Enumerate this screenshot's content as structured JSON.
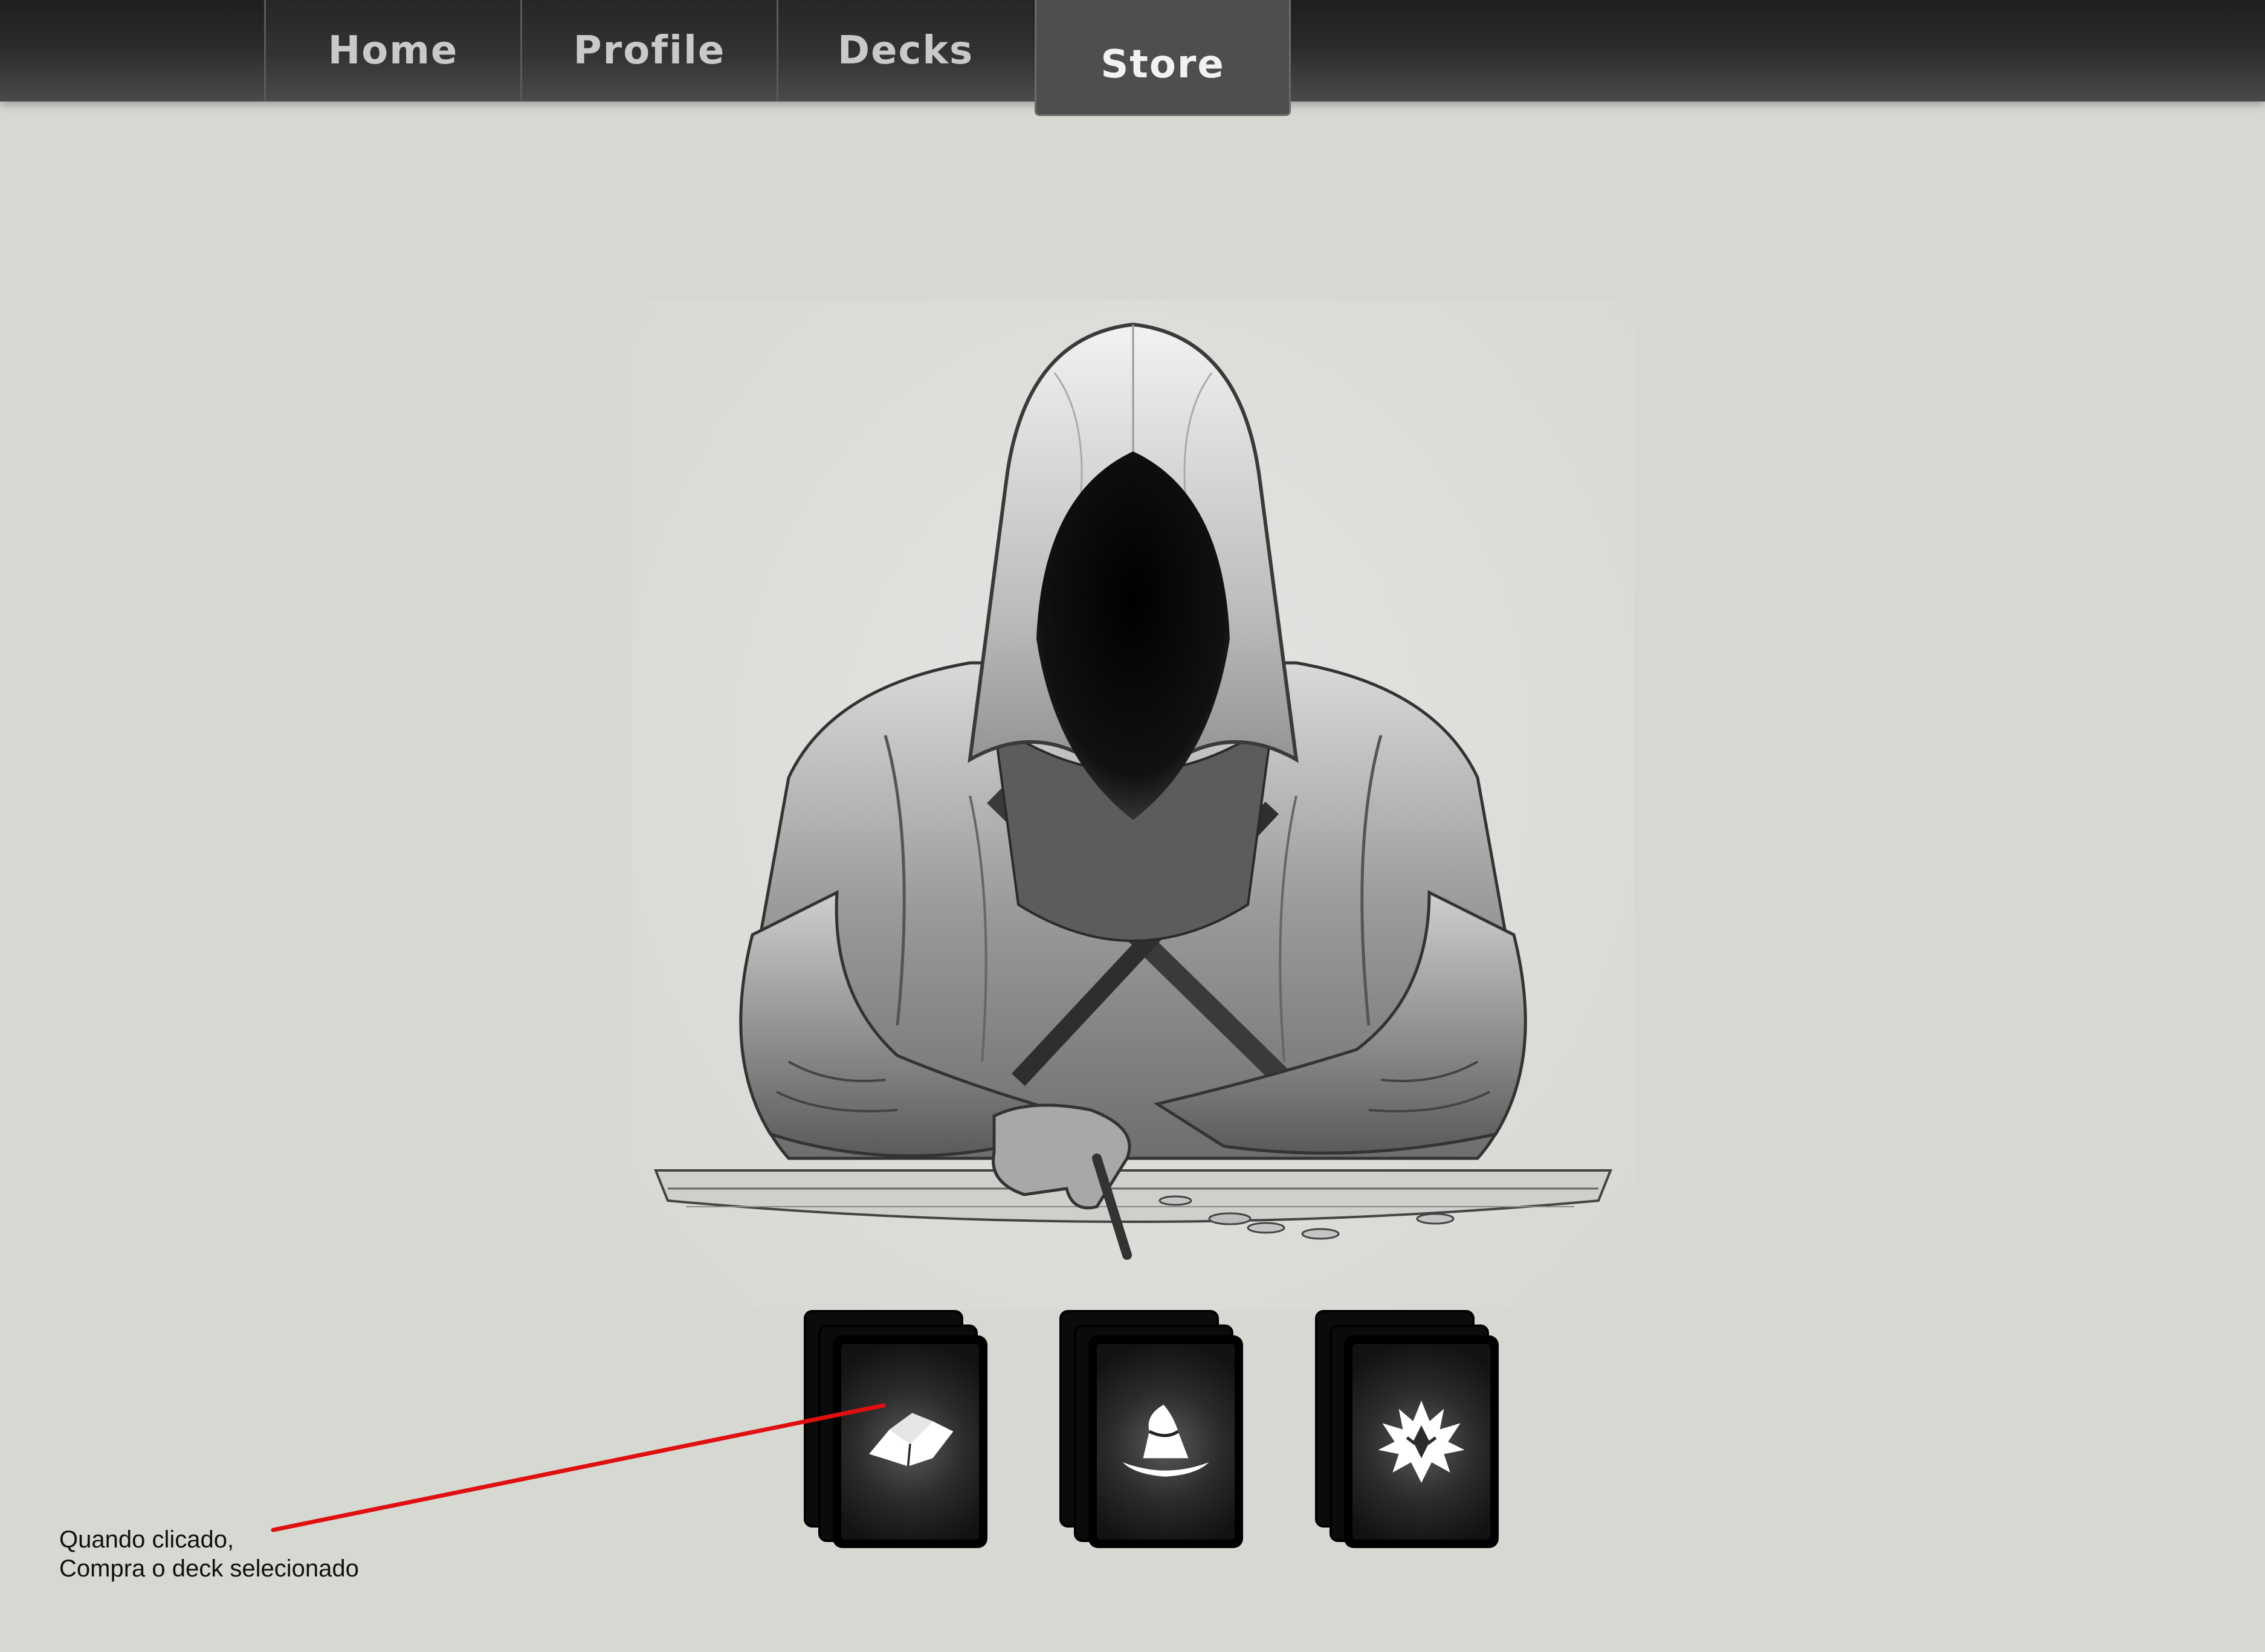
{
  "nav": {
    "tabs": [
      {
        "label": "Home",
        "active": false
      },
      {
        "label": "Profile",
        "active": false
      },
      {
        "label": "Decks",
        "active": false
      },
      {
        "label": "Store",
        "active": true
      }
    ]
  },
  "store": {
    "decks": [
      {
        "icon": "open-book-icon"
      },
      {
        "icon": "wizard-hat-icon"
      },
      {
        "icon": "dragon-emblem-icon"
      }
    ]
  },
  "annotation": {
    "line1": "Quando clicado,",
    "line2": "Compra o deck selecionado",
    "color": "#e01010"
  },
  "colors": {
    "background": "#d6d8d2",
    "navbar": "#2a2a2a",
    "active_tab": "#4e4e4e"
  }
}
